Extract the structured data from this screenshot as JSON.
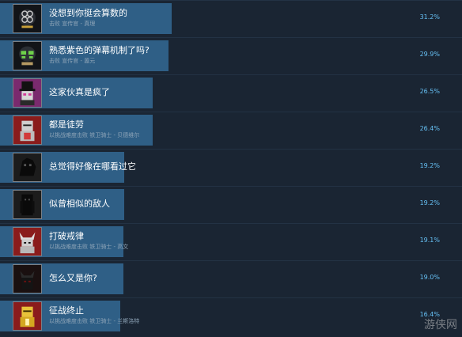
{
  "achievements": [
    {
      "title": "没想到你挺会算数的",
      "desc": "击败 宣传官 - 真理",
      "percent": "31.2%",
      "fill": 0.372,
      "icon": "skull-icon",
      "accent": "#c8c8c8"
    },
    {
      "title": "熟悉紫色的弹幕机制了吗?",
      "desc": "击败 宣传官 - 嚣元",
      "percent": "29.9%",
      "fill": 0.365,
      "icon": "green-skull-icon",
      "accent": "#6fd24a"
    },
    {
      "title": "这家伙真是疯了",
      "desc": "",
      "percent": "26.5%",
      "fill": 0.33,
      "icon": "top-hat-villain-icon",
      "accent": "#d23c9b"
    },
    {
      "title": "都是徒劳",
      "desc": "以挑战难度击败 铁卫骑士 - 贝德维尔",
      "percent": "26.4%",
      "fill": 0.33,
      "icon": "armored-knight-icon",
      "accent": "#d23a3a"
    },
    {
      "title": "总觉得好像在哪看过它",
      "desc": "",
      "percent": "19.2%",
      "fill": 0.268,
      "icon": "shadow-beast-icon",
      "accent": "#444444"
    },
    {
      "title": "似曾相似的敌人",
      "desc": "",
      "percent": "19.2%",
      "fill": 0.268,
      "icon": "shadow-figure-icon",
      "accent": "#444444"
    },
    {
      "title": "打破戒律",
      "desc": "以挑战难度击败 铁卫骑士 - 高文",
      "percent": "19.1%",
      "fill": 0.267,
      "icon": "horned-knight-icon",
      "accent": "#d23a3a"
    },
    {
      "title": "怎么又是你?",
      "desc": "",
      "percent": "19.0%",
      "fill": 0.267,
      "icon": "dark-knight-icon",
      "accent": "#3a1010"
    },
    {
      "title": "征战终止",
      "desc": "以挑战难度击败 铁卫骑士 - 兰斯洛特",
      "percent": "16.4%",
      "fill": 0.26,
      "icon": "golden-knight-icon",
      "accent": "#e8c23a"
    }
  ],
  "watermark": "游侠网"
}
